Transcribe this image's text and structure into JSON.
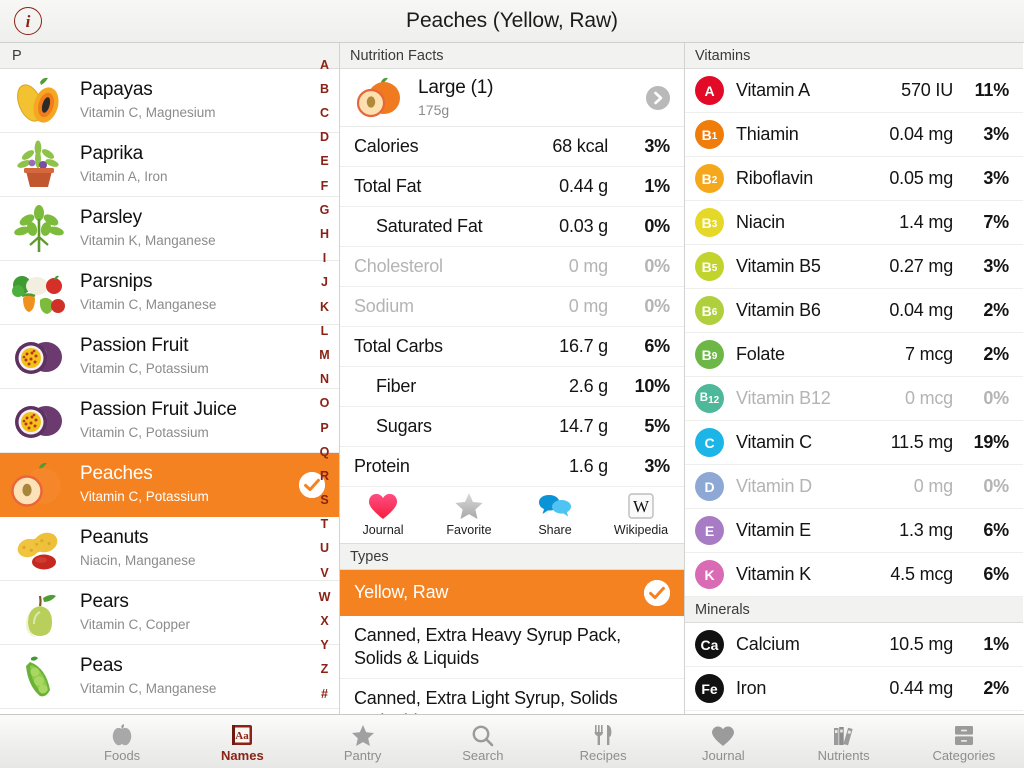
{
  "topbar": {
    "title": "Peaches (Yellow, Raw)",
    "info_icon": "info-icon",
    "info_label": "i"
  },
  "colors": {
    "accent_orange": "#f58220",
    "brand_red": "#8a2216",
    "muted_gray": "#b4b4b4",
    "section_header_bg": "#f2f2f0"
  },
  "left_panel": {
    "section_letter": "P",
    "alpha_index": [
      "A",
      "B",
      "C",
      "D",
      "E",
      "F",
      "G",
      "H",
      "I",
      "J",
      "K",
      "L",
      "M",
      "N",
      "O",
      "P",
      "Q",
      "R",
      "S",
      "T",
      "U",
      "V",
      "W",
      "X",
      "Y",
      "Z",
      "#"
    ],
    "foods": [
      {
        "name": "Papayas",
        "nutrients": "Vitamin C, Magnesium",
        "icon": "papaya-icon",
        "selected": false
      },
      {
        "name": "Paprika",
        "nutrients": "Vitamin A, Iron",
        "icon": "paprika-plant-icon",
        "selected": false
      },
      {
        "name": "Parsley",
        "nutrients": "Vitamin K, Manganese",
        "icon": "parsley-icon",
        "selected": false
      },
      {
        "name": "Parsnips",
        "nutrients": "Vitamin C, Manganese",
        "icon": "mixed-vegetables-icon",
        "selected": false
      },
      {
        "name": "Passion Fruit",
        "nutrients": "Vitamin C, Potassium",
        "icon": "passion-fruit-icon",
        "selected": false
      },
      {
        "name": "Passion Fruit Juice",
        "nutrients": "Vitamin C, Potassium",
        "icon": "passion-fruit-icon",
        "selected": false
      },
      {
        "name": "Peaches",
        "nutrients": "Vitamin C, Potassium",
        "icon": "peach-icon",
        "selected": true
      },
      {
        "name": "Peanuts",
        "nutrients": "Niacin, Manganese",
        "icon": "peanut-icon",
        "selected": false
      },
      {
        "name": "Pears",
        "nutrients": "Vitamin C, Copper",
        "icon": "pear-icon",
        "selected": false
      },
      {
        "name": "Peas",
        "nutrients": "Vitamin C, Manganese",
        "icon": "peas-icon",
        "selected": false
      }
    ]
  },
  "middle_panel": {
    "section_title": "Nutrition Facts",
    "serving": {
      "name": "Large (1)",
      "weight": "175g",
      "icon": "peach-icon",
      "disclosure_icon": "chevron-right-icon"
    },
    "facts": [
      {
        "label": "Calories",
        "amount": "68 kcal",
        "pct": "3%",
        "indent": false,
        "zero": false
      },
      {
        "label": "Total Fat",
        "amount": "0.44 g",
        "pct": "1%",
        "indent": false,
        "zero": false
      },
      {
        "label": "Saturated Fat",
        "amount": "0.03 g",
        "pct": "0%",
        "indent": true,
        "zero": false
      },
      {
        "label": "Cholesterol",
        "amount": "0 mg",
        "pct": "0%",
        "indent": false,
        "zero": true
      },
      {
        "label": "Sodium",
        "amount": "0 mg",
        "pct": "0%",
        "indent": false,
        "zero": true
      },
      {
        "label": "Total Carbs",
        "amount": "16.7 g",
        "pct": "6%",
        "indent": false,
        "zero": false
      },
      {
        "label": "Fiber",
        "amount": "2.6 g",
        "pct": "10%",
        "indent": true,
        "zero": false
      },
      {
        "label": "Sugars",
        "amount": "14.7 g",
        "pct": "5%",
        "indent": true,
        "zero": false
      },
      {
        "label": "Protein",
        "amount": "1.6 g",
        "pct": "3%",
        "indent": false,
        "zero": false
      }
    ],
    "actions": [
      {
        "label": "Journal",
        "icon": "heart-icon"
      },
      {
        "label": "Favorite",
        "icon": "star-icon"
      },
      {
        "label": "Share",
        "icon": "speech-bubbles-icon"
      },
      {
        "label": "Wikipedia",
        "icon": "wikipedia-icon"
      }
    ],
    "types_title": "Types",
    "types": [
      {
        "label": "Yellow, Raw",
        "selected": true
      },
      {
        "label": "Canned, Extra Heavy Syrup Pack, Solids & Liquids",
        "selected": false
      },
      {
        "label": "Canned, Extra Light Syrup, Solids & Liquids",
        "selected": false
      }
    ]
  },
  "right_panel": {
    "vitamins_title": "Vitamins",
    "minerals_title": "Minerals",
    "vitamins": [
      {
        "badge": "A",
        "badge_color": "#e30a28",
        "name": "Vitamin A",
        "amount": "570 IU",
        "pct": "11%",
        "zero": false
      },
      {
        "badge": "B1",
        "badge_color": "#f07c0a",
        "name": "Thiamin",
        "amount": "0.04 mg",
        "pct": "3%",
        "zero": false
      },
      {
        "badge": "B2",
        "badge_color": "#f5a81c",
        "name": "Riboflavin",
        "amount": "0.05 mg",
        "pct": "3%",
        "zero": false
      },
      {
        "badge": "B3",
        "badge_color": "#e5d827",
        "name": "Niacin",
        "amount": "1.4 mg",
        "pct": "7%",
        "zero": false
      },
      {
        "badge": "B5",
        "badge_color": "#c2d32e",
        "name": "Vitamin B5",
        "amount": "0.27 mg",
        "pct": "3%",
        "zero": false
      },
      {
        "badge": "B6",
        "badge_color": "#afcf3c",
        "name": "Vitamin B6",
        "amount": "0.04 mg",
        "pct": "2%",
        "zero": false
      },
      {
        "badge": "B9",
        "badge_color": "#6cb745",
        "name": "Folate",
        "amount": "7 mcg",
        "pct": "2%",
        "zero": false
      },
      {
        "badge": "B12",
        "badge_color": "#4db89a",
        "name": "Vitamin B12",
        "amount": "0 mcg",
        "pct": "0%",
        "zero": true
      },
      {
        "badge": "C",
        "badge_color": "#1cb5e8",
        "name": "Vitamin C",
        "amount": "11.5 mg",
        "pct": "19%",
        "zero": false
      },
      {
        "badge": "D",
        "badge_color": "#8da8d4",
        "name": "Vitamin D",
        "amount": "0 mg",
        "pct": "0%",
        "zero": true
      },
      {
        "badge": "E",
        "badge_color": "#a77cc4",
        "name": "Vitamin E",
        "amount": "1.3 mg",
        "pct": "6%",
        "zero": false
      },
      {
        "badge": "K",
        "badge_color": "#d濃",
        "name": "Vitamin K",
        "amount": "4.5 mcg",
        "pct": "6%",
        "zero": false
      }
    ],
    "minerals": [
      {
        "badge": "Ca",
        "badge_color": "#111111",
        "name": "Calcium",
        "amount": "10.5 mg",
        "pct": "1%",
        "zero": false
      },
      {
        "badge": "Fe",
        "badge_color": "#111111",
        "name": "Iron",
        "amount": "0.44 mg",
        "pct": "2%",
        "zero": false
      }
    ]
  },
  "tabbar": {
    "tabs": [
      {
        "label": "Foods",
        "icon": "apple-icon",
        "active": false
      },
      {
        "label": "Names",
        "icon": "book-aa-icon",
        "active": true
      },
      {
        "label": "Pantry",
        "icon": "star-icon",
        "active": false
      },
      {
        "label": "Search",
        "icon": "search-icon",
        "active": false
      },
      {
        "label": "Recipes",
        "icon": "fork-knife-icon",
        "active": false
      },
      {
        "label": "Journal",
        "icon": "heart-icon",
        "active": false
      },
      {
        "label": "Nutrients",
        "icon": "books-icon",
        "active": false
      },
      {
        "label": "Categories",
        "icon": "drawers-icon",
        "active": false
      }
    ]
  }
}
